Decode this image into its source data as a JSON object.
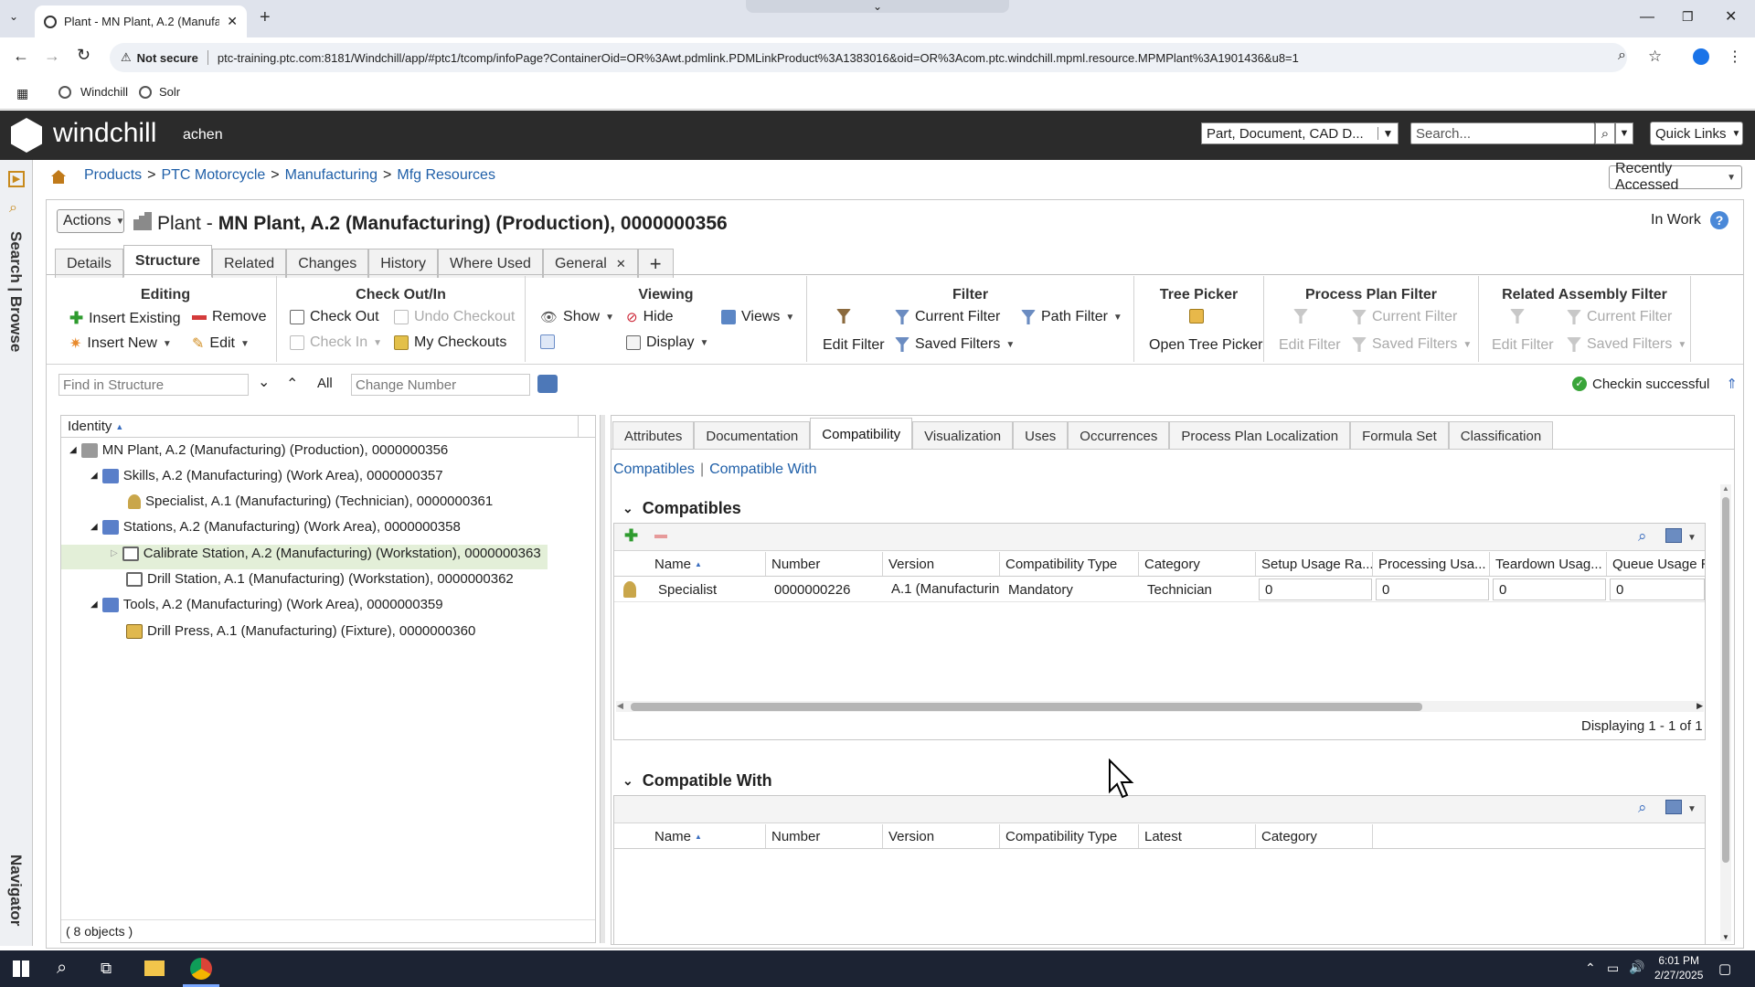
{
  "browser": {
    "tab_title": "Plant - MN Plant, A.2 (Manufactu",
    "security_label": "Not secure",
    "url": "ptc-training.ptc.com:8181/Windchill/app/#ptc1/tcomp/infoPage?ContainerOid=OR%3Awt.pdmlink.PDMLinkProduct%3A1383016&oid=OR%3Acom.ptc.windchill.mpml.resource.MPMPlant%3A1901436&u8=1",
    "bookmarks": [
      "Windchill",
      "Solr"
    ]
  },
  "header": {
    "app_name": "windchill",
    "user": "achen",
    "search_type": "Part, Document, CAD D...",
    "search_placeholder": "Search...",
    "quick_links": "Quick Links",
    "recently_accessed": "Recently Accessed"
  },
  "rail": {
    "search_browse": "Search | Browse",
    "navigator": "Navigator"
  },
  "breadcrumb": [
    "Products",
    "PTC Motorcycle",
    "Manufacturing",
    "Mfg Resources"
  ],
  "page": {
    "actions": "Actions",
    "title_prefix": "Plant -",
    "title": "MN Plant, A.2 (Manufacturing) (Production), 0000000356",
    "state": "In Work",
    "tabs": [
      "Details",
      "Structure",
      "Related",
      "Changes",
      "History",
      "Where Used",
      "General"
    ]
  },
  "toolbar": {
    "editing": {
      "title": "Editing",
      "insert_existing": "Insert Existing",
      "remove": "Remove",
      "insert_new": "Insert New",
      "edit": "Edit"
    },
    "checkout": {
      "title": "Check Out/In",
      "check_out": "Check Out",
      "undo_checkout": "Undo Checkout",
      "check_in": "Check In",
      "my_checkouts": "My Checkouts"
    },
    "viewing": {
      "title": "Viewing",
      "show": "Show",
      "hide": "Hide",
      "views": "Views",
      "display": "Display"
    },
    "filter": {
      "title": "Filter",
      "edit_filter": "Edit Filter",
      "current_filter": "Current Filter",
      "path_filter": "Path Filter",
      "saved_filters": "Saved Filters"
    },
    "tree_picker": {
      "title": "Tree Picker",
      "open": "Open Tree Picker"
    },
    "process_plan_filter": {
      "title": "Process Plan Filter",
      "edit_filter": "Edit Filter",
      "current_filter": "Current Filter",
      "saved_filters": "Saved Filters"
    },
    "related_assembly_filter": {
      "title": "Related Assembly Filter",
      "edit_filter": "Edit Filter",
      "current_filter": "Current Filter",
      "saved_filters": "Saved Filters"
    }
  },
  "findbar": {
    "find_placeholder": "Find in Structure",
    "all": "All",
    "change_placeholder": "Change Number",
    "status": "Checkin successful"
  },
  "tree": {
    "header": "Identity",
    "items": [
      "MN Plant, A.2 (Manufacturing) (Production), 0000000356",
      "Skills, A.2 (Manufacturing) (Work Area), 0000000357",
      "Specialist, A.1 (Manufacturing) (Technician), 0000000361",
      "Stations, A.2 (Manufacturing) (Work Area), 0000000358",
      "Calibrate Station, A.2 (Manufacturing) (Workstation), 0000000363",
      "Drill Station, A.1 (Manufacturing) (Workstation), 0000000362",
      "Tools, A.2 (Manufacturing) (Work Area), 0000000359",
      "Drill Press, A.1 (Manufacturing) (Fixture), 0000000360"
    ],
    "footer": "( 8 objects )"
  },
  "right": {
    "tabs": [
      "Attributes",
      "Documentation",
      "Compatibility",
      "Visualization",
      "Uses",
      "Occurrences",
      "Process Plan Localization",
      "Formula Set",
      "Classification"
    ],
    "sublinks": [
      "Compatibles",
      "Compatible With"
    ],
    "compatibles": {
      "title": "Compatibles",
      "columns": [
        "Name",
        "Number",
        "Version",
        "Compatibility Type",
        "Category",
        "Setup Usage Ra...",
        "Processing Usa...",
        "Teardown Usag...",
        "Queue Usage R"
      ],
      "rows": [
        [
          "Specialist",
          "0000000226",
          "A.1 (Manufacturin",
          "Mandatory",
          "Technician",
          "0",
          "0",
          "0",
          "0"
        ]
      ],
      "footer": "Displaying 1 - 1 of 1"
    },
    "compatible_with": {
      "title": "Compatible With",
      "columns": [
        "Name",
        "Number",
        "Version",
        "Compatibility Type",
        "Latest",
        "Category"
      ]
    }
  },
  "taskbar": {
    "time": "6:01 PM",
    "date": "2/27/2025"
  }
}
